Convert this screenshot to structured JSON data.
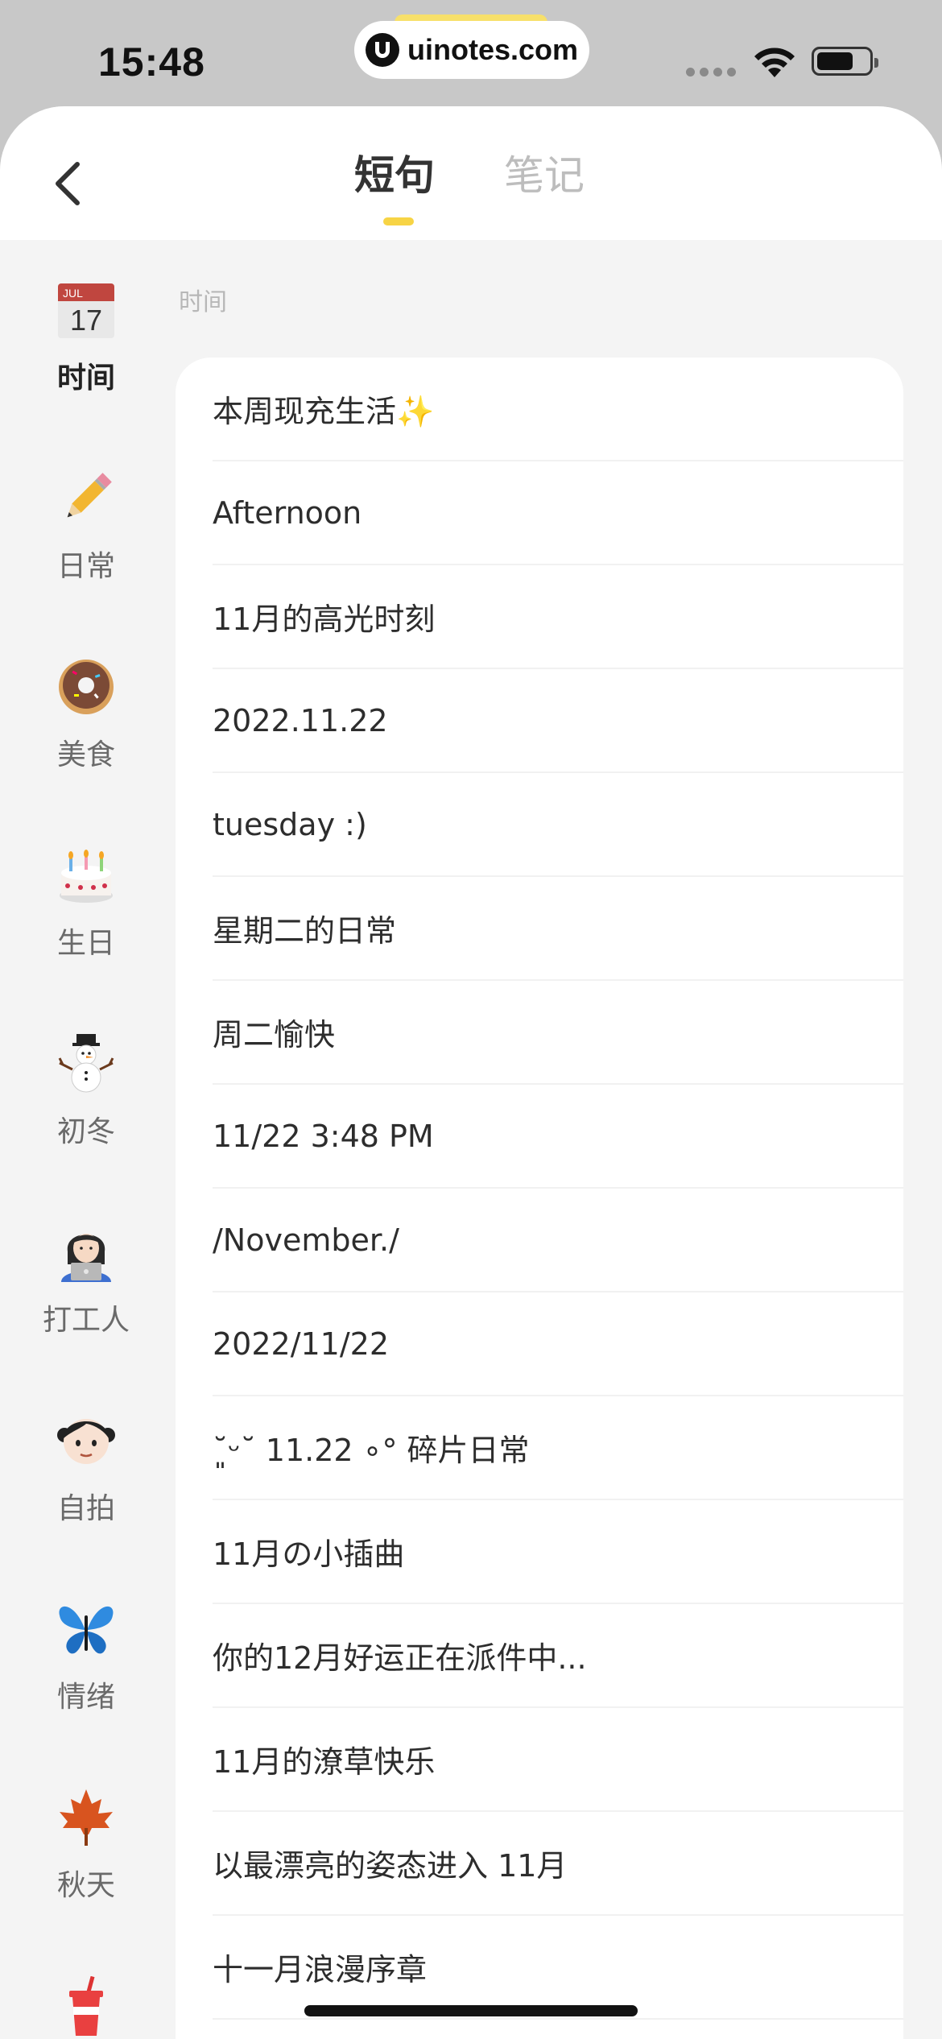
{
  "status_bar": {
    "time": "15:48",
    "url": "uinotes.com"
  },
  "header": {
    "tabs": [
      {
        "label": "短句",
        "active": true
      },
      {
        "label": "笔记",
        "active": false
      }
    ],
    "accent_color": "#f7d445"
  },
  "sidebar": {
    "items": [
      {
        "label": "时间",
        "icon": "calendar-icon",
        "active": true
      },
      {
        "label": "日常",
        "icon": "pencil-icon",
        "active": false
      },
      {
        "label": "美食",
        "icon": "donut-icon",
        "active": false
      },
      {
        "label": "生日",
        "icon": "cake-icon",
        "active": false
      },
      {
        "label": "初冬",
        "icon": "snowman-icon",
        "active": false
      },
      {
        "label": "打工人",
        "icon": "technologist-icon",
        "active": false
      },
      {
        "label": "自拍",
        "icon": "girl-face-icon",
        "active": false
      },
      {
        "label": "情绪",
        "icon": "butterfly-icon",
        "active": false
      },
      {
        "label": "秋天",
        "icon": "maple-leaf-icon",
        "active": false
      },
      {
        "label": "",
        "icon": "drink-cup-icon",
        "active": false
      }
    ],
    "calendar_icon": {
      "month": "JUL",
      "day": "17"
    }
  },
  "main": {
    "section_label": "时间",
    "phrases": [
      "本周现充生活✨",
      "Afternoon",
      "11月的高光时刻",
      "2022.11.22",
      "tuesday :)",
      "星期二的日常",
      "周二愉快",
      "11/22 3:48 PM",
      "/November./",
      "2022/11/22",
      "˘͈ᵕ˘ 11.22 ∘° 碎片日常",
      "11月の小插曲",
      "你的12月好运正在派件中...",
      "11月的潦草快乐",
      "以最漂亮的姿态进入 11月",
      "十一月浪漫序章"
    ]
  }
}
